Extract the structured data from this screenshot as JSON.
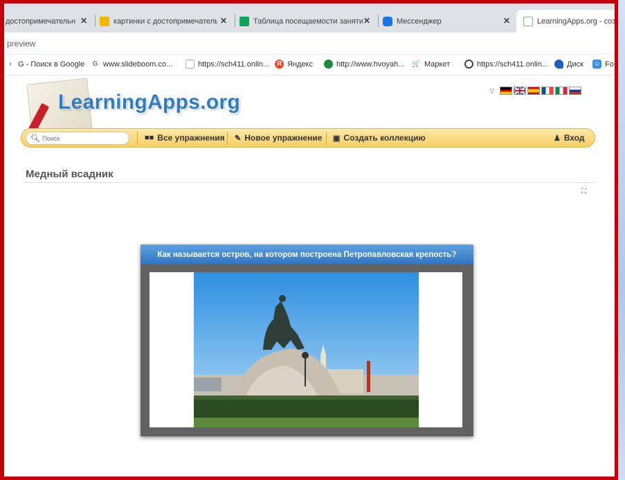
{
  "browser": {
    "tabs": [
      {
        "label": "достопримечательн",
        "icon": "page-icon"
      },
      {
        "label": "картинки с достопримечательн",
        "icon": "image-icon"
      },
      {
        "label": "Таблица посещаемости заняти",
        "icon": "sheet-icon"
      },
      {
        "label": "Мессенджер",
        "icon": "chat-icon"
      },
      {
        "label": "LearningApps.org - созда",
        "icon": "learningapps-icon"
      }
    ],
    "close_glyph": "✕",
    "address_text": "preview",
    "bookmarks": [
      {
        "label": "G - Поиск в Google",
        "icon": "google-icon"
      },
      {
        "label": "www.slideboom.co...",
        "icon": "google-icon"
      },
      {
        "label": "https://sch411.onlin...",
        "icon": "shield-icon"
      },
      {
        "label": "Яндекс",
        "icon": "yandex-icon"
      },
      {
        "label": "http://www.hvoyah...",
        "icon": "globe-icon"
      },
      {
        "label": "Маркет",
        "icon": "cart-icon"
      },
      {
        "label": "https://sch411.onlin...",
        "icon": "globe-icon"
      },
      {
        "label": "Диск",
        "icon": "disk-icon"
      },
      {
        "label": "Fo",
        "icon": "photo-icon"
      }
    ]
  },
  "site": {
    "logo_text": "LearningApps.org",
    "flags": [
      "de",
      "gb",
      "es",
      "fr",
      "it",
      "ru"
    ],
    "nav": {
      "search_placeholder": "Поиск",
      "all_exercises": "Все упражнения",
      "new_exercise": "Новое упражнение",
      "create_collection": "Создать коллекцию",
      "login": "Вход"
    },
    "page_title": "Медный всадник",
    "question": "Как называется остров, на котором построена Петропавловская крепость?"
  },
  "colors": {
    "frame_border": "#c4000b",
    "nav_yellow": "#f7cf63",
    "logo_blue": "#2f7cc2",
    "question_blue": "#2f74c0"
  }
}
